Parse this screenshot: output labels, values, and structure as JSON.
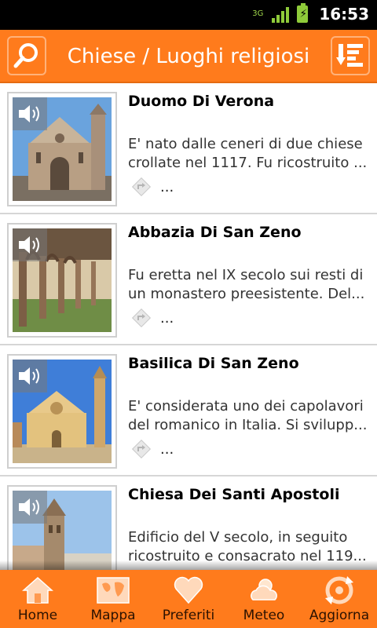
{
  "status": {
    "network": "3G",
    "time": "16:53"
  },
  "header": {
    "title": "Chiese / Luoghi religiosi",
    "search_icon": "search-icon",
    "sort_icon": "sort-list-icon"
  },
  "items": [
    {
      "title": "Duomo Di Verona",
      "line1": "E' nato dalle ceneri di due chiese",
      "line2": "crollate nel 1117. Fu ricostruito ...",
      "more": "..."
    },
    {
      "title": "Abbazia Di San Zeno",
      "line1": "Fu eretta nel IX secolo sui resti di",
      "line2": "un monastero preesistente. Del...",
      "more": "..."
    },
    {
      "title": "Basilica Di San Zeno",
      "line1": "E' considerata uno dei capolavori",
      "line2": "del romanico in Italia. Si svilupp...",
      "more": "..."
    },
    {
      "title": "Chiesa Dei Santi Apostoli",
      "line1": "Edificio del V secolo, in seguito",
      "line2": "ricostruito e consacrato nel 119...",
      "more": ""
    }
  ],
  "tabs": [
    {
      "label": "Home",
      "icon": "home-icon"
    },
    {
      "label": "Mappa",
      "icon": "map-icon"
    },
    {
      "label": "Preferiti",
      "icon": "heart-icon"
    },
    {
      "label": "Meteo",
      "icon": "weather-icon"
    },
    {
      "label": "Aggiorna",
      "icon": "refresh-icon"
    }
  ],
  "colors": {
    "accent": "#ff7b1c",
    "status_bar": "#000000"
  }
}
